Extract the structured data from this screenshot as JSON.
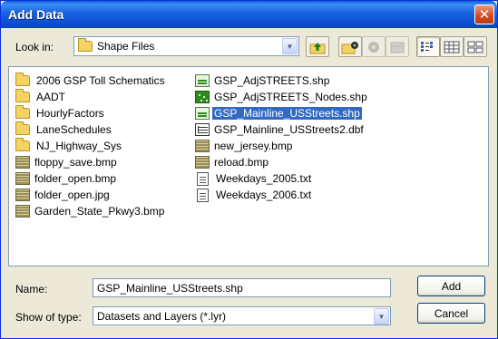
{
  "window": {
    "title": "Add Data"
  },
  "toolbar": {
    "look_in_label": "Look in:",
    "current_folder": "Shape Files"
  },
  "files": {
    "col1": [
      {
        "name": "2006 GSP Toll Schematics",
        "icon": "folder-icon"
      },
      {
        "name": "AADT",
        "icon": "folder-icon"
      },
      {
        "name": "HourlyFactors",
        "icon": "folder-icon"
      },
      {
        "name": "LaneSchedules",
        "icon": "folder-icon"
      },
      {
        "name": "NJ_Highway_Sys",
        "icon": "folder-icon"
      },
      {
        "name": "floppy_save.bmp",
        "icon": "bitmap-icon"
      },
      {
        "name": "folder_open.bmp",
        "icon": "bitmap-icon"
      },
      {
        "name": "folder_open.jpg",
        "icon": "bitmap-icon"
      },
      {
        "name": "Garden_State_Pkwy3.bmp",
        "icon": "bitmap-icon"
      }
    ],
    "col2": [
      {
        "name": "GSP_AdjSTREETS.shp",
        "icon": "line-shapefile-icon"
      },
      {
        "name": "GSP_AdjSTREETS_Nodes.shp",
        "icon": "point-shapefile-icon"
      },
      {
        "name": "GSP_Mainline_USStreets.shp",
        "icon": "line-shapefile-icon",
        "selected": true
      },
      {
        "name": "GSP_Mainline_USStreets2.dbf",
        "icon": "table-icon"
      },
      {
        "name": "new_jersey.bmp",
        "icon": "bitmap-icon"
      },
      {
        "name": "reload.bmp",
        "icon": "bitmap-icon"
      },
      {
        "name": "Weekdays_2005.txt",
        "icon": "text-file-icon"
      },
      {
        "name": "Weekdays_2006.txt",
        "icon": "text-file-icon"
      }
    ]
  },
  "form": {
    "name_label": "Name:",
    "name_value": "GSP_Mainline_USStreets.shp",
    "type_label": "Show of type:",
    "type_value": "Datasets and Layers (*.lyr)",
    "add_label": "Add",
    "cancel_label": "Cancel"
  },
  "colors": {
    "titlebar": "#0a5fd8",
    "selection": "#316ac5",
    "dialog": "#ece9d8"
  }
}
